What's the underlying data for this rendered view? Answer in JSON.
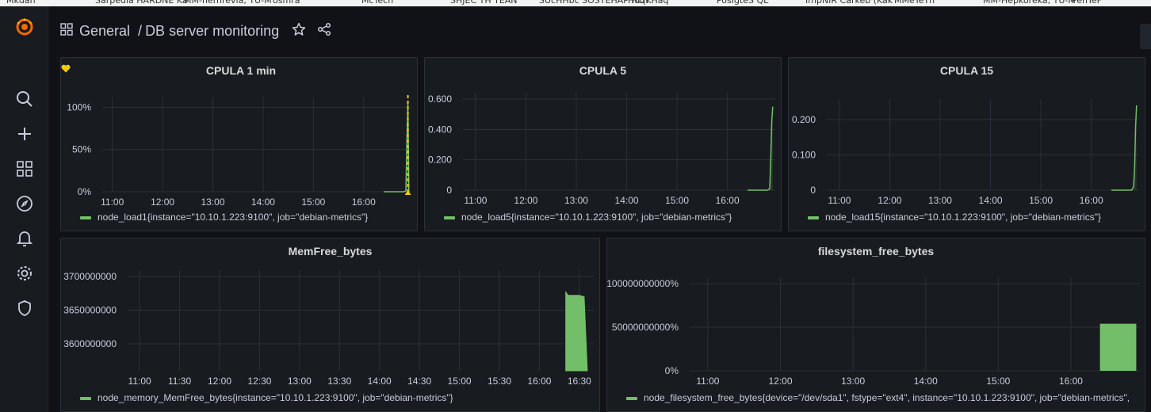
{
  "bookmarks": [
    "Mkdan",
    "Sarpedia  HARDNE Ka",
    "MM-nerhrevia, TU-M",
    "osmra",
    "McTech",
    "SHJEC TH YEAN",
    "SUcHHbc SOSTEHAP  HOT",
    "HuqKHaq",
    "PosIgteS QL",
    "ImpNIR  Carkeb (Kak",
    "MMeTeTn",
    "MM-Hepkoreka, TU-M",
    "PenTeF"
  ],
  "header": {
    "section": "General",
    "separator": "/",
    "title": "DB server monitoring"
  },
  "panels": {
    "cpu1": {
      "title": "CPULA 1 min",
      "legend": "node_load1{instance=\"10.10.1.223:9100\", job=\"debian-metrics\"}"
    },
    "cpu5": {
      "title": "CPULA 5",
      "legend": "node_load5{instance=\"10.10.1.223:9100\", job=\"debian-metrics\"}"
    },
    "cpu15": {
      "title": "CPULA 15",
      "legend": "node_load15{instance=\"10.10.1.223:9100\", job=\"debian-metrics\"}"
    },
    "mem": {
      "title": "MemFree_bytes",
      "legend": "node_memory_MemFree_bytes{instance=\"10.10.1.223:9100\", job=\"debian-metrics\"}"
    },
    "fs": {
      "title": "filesystem_free_bytes",
      "legend": "node_filesystem_free_bytes{device=\"/dev/sda1\", fstype=\"ext4\", instance=\"10.10.1.223:9100\", job=\"debian-metrics\","
    }
  },
  "colors": {
    "series": "#73bf69",
    "alert": "#f2cc0c",
    "grid": "#2c3039",
    "brand": "#f46800"
  },
  "chart_data": [
    {
      "id": "cpu1",
      "type": "line",
      "x_ticks": [
        "11:00",
        "12:00",
        "13:00",
        "14:00",
        "15:00",
        "16:00"
      ],
      "y_ticks": [
        "0%",
        "50%",
        "100%"
      ],
      "ylim": [
        0,
        1.05
      ],
      "series": [
        {
          "name": "node_load1{instance=\"10.10.1.223:9100\", job=\"debian-metrics\"}",
          "x": [
            16.4,
            16.8,
            16.84,
            16.86,
            16.88,
            16.9
          ],
          "y": [
            0,
            0,
            0.01,
            0.6,
            1.05,
            0
          ]
        }
      ]
    },
    {
      "id": "cpu5",
      "type": "line",
      "x_ticks": [
        "11:00",
        "12:00",
        "13:00",
        "14:00",
        "15:00",
        "16:00"
      ],
      "y_ticks": [
        "0",
        "0.200",
        "0.400",
        "0.600"
      ],
      "ylim": [
        0,
        0.6
      ],
      "series": [
        {
          "name": "node_load5{instance=\"10.10.1.223:9100\", job=\"debian-metrics\"}",
          "x": [
            16.4,
            16.8,
            16.84,
            16.86,
            16.88,
            16.9
          ],
          "y": [
            0,
            0,
            0.01,
            0.2,
            0.45,
            0.55
          ]
        }
      ]
    },
    {
      "id": "cpu15",
      "type": "line",
      "x_ticks": [
        "11:00",
        "12:00",
        "13:00",
        "14:00",
        "15:00",
        "16:00"
      ],
      "y_ticks": [
        "0",
        "0.100",
        "0.200"
      ],
      "ylim": [
        0,
        0.24
      ],
      "series": [
        {
          "name": "node_load15{instance=\"10.10.1.223:9100\", job=\"debian-metrics\"}",
          "x": [
            16.4,
            16.8,
            16.84,
            16.86,
            16.88,
            16.9
          ],
          "y": [
            0,
            0,
            0.01,
            0.06,
            0.18,
            0.24
          ]
        }
      ]
    },
    {
      "id": "mem",
      "type": "area",
      "x_ticks": [
        "11:00",
        "11:30",
        "12:00",
        "12:30",
        "13:00",
        "13:30",
        "14:00",
        "14:30",
        "15:00",
        "15:30",
        "16:00",
        "16:30"
      ],
      "y_ticks": [
        "3600000000",
        "3650000000",
        "3700000000"
      ],
      "ylim": [
        3560000000,
        3700000000
      ],
      "series": [
        {
          "name": "node_memory_MemFree_bytes{instance=\"10.10.1.223:9100\", job=\"debian-metrics\"}",
          "x": [
            16.33,
            16.36,
            16.5,
            16.56,
            16.6
          ],
          "y": [
            3677000000,
            3672000000,
            3672000000,
            3670000000,
            3560000000
          ]
        }
      ]
    },
    {
      "id": "fs",
      "type": "bar",
      "x_ticks": [
        "11:00",
        "12:00",
        "13:00",
        "14:00",
        "15:00",
        "16:00"
      ],
      "y_ticks": [
        "0%",
        "50000000000%",
        "100000000000%"
      ],
      "ylim": [
        0,
        100000000000
      ],
      "series": [
        {
          "name": "node_filesystem_free_bytes{device=\"/dev/sda1\", fstype=\"ext4\", instance=\"10.10.1.223:9100\", job=\"debian-metrics\",",
          "x": [
            16.4,
            16.9
          ],
          "y": [
            54000000000,
            54000000000
          ]
        }
      ]
    }
  ]
}
